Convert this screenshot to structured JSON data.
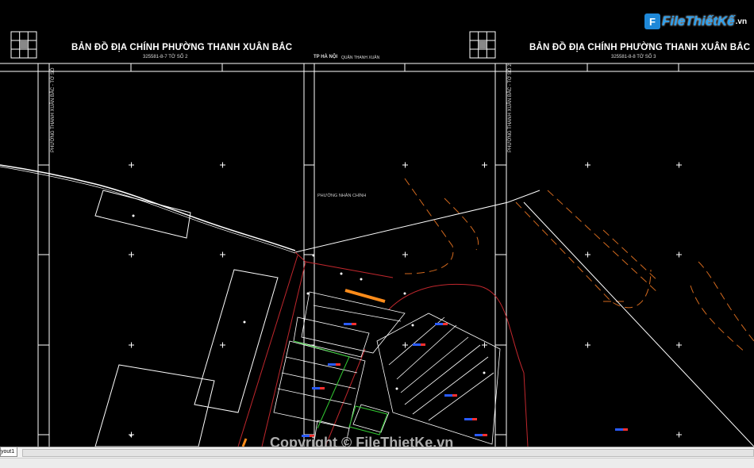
{
  "sheet_left": {
    "title": "BẢN ĐỒ ĐỊA CHÍNH PHƯỜNG THANH XUÂN BẮC",
    "sheet_code": "325581-8-7 TỜ SỐ 2"
  },
  "sheet_right": {
    "title": "BẢN ĐỒ ĐỊA CHÍNH PHƯỜNG THANH XUÂN BẮC",
    "sheet_code": "325581-8-8 TỜ SỐ 3"
  },
  "city_label": "TP HÀ NỘI",
  "district_label": "QUẬN THANH XUÂN",
  "vertical_left": "PHƯỜNG THANH XUÂN BẮC - TỜ SỐ",
  "vertical_mid": "PHƯỜNG THANH XUÂN BẮC - TỜ SỐ 2",
  "neighbor_ward": "PHƯỜNG NHÂN CHÍNH",
  "logo": {
    "main": "FileThiếtKế",
    "suffix": ".vn"
  },
  "watermark": "Copyright © FileThietKe.vn",
  "layout_tab": "yout1",
  "colors": {
    "cad_white": "#ffffff",
    "boundary_red": "#c0272d",
    "dashed_orange": "#d2691e",
    "highlight_orange": "#ff8c1a",
    "green": "#33cc33"
  }
}
